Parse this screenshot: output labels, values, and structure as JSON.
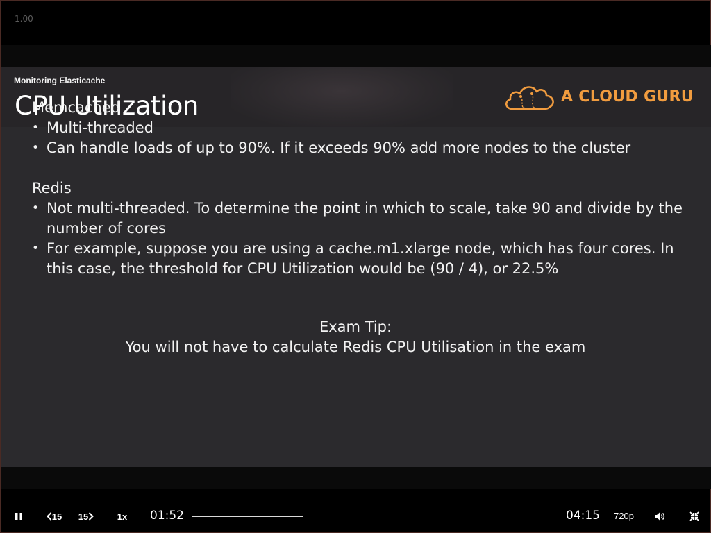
{
  "player": {
    "rate_readout": "1.00",
    "elapsed": "01:52",
    "duration": "04:15",
    "speed_label": "1x",
    "quality_label": "720p",
    "rewind_label": "15",
    "forward_label": "15",
    "progress_fraction": 1.0
  },
  "slide": {
    "section": "Monitoring Elasticache",
    "title": "CPU Utilization",
    "brand": "A CLOUD GURU",
    "memcached": {
      "heading": "Memcached",
      "bullets": [
        "Multi-threaded",
        "Can handle loads of up to 90%. If it exceeds 90% add more nodes to the cluster"
      ]
    },
    "redis": {
      "heading": "Redis",
      "bullets": [
        "Not multi-threaded. To determine the point in which to scale, take 90 and divide by the number of cores",
        "For example, suppose you are using a cache.m1.xlarge node, which has four cores. In this case, the threshold for CPU Utilization would be (90 / 4), or 22.5%"
      ]
    },
    "exam_tip": {
      "heading": "Exam Tip:",
      "text": "You will not have to calculate Redis CPU Utilisation in the exam"
    }
  },
  "colors": {
    "brand_orange": "#f19c3f",
    "slide_bg": "#2b2a2d"
  }
}
